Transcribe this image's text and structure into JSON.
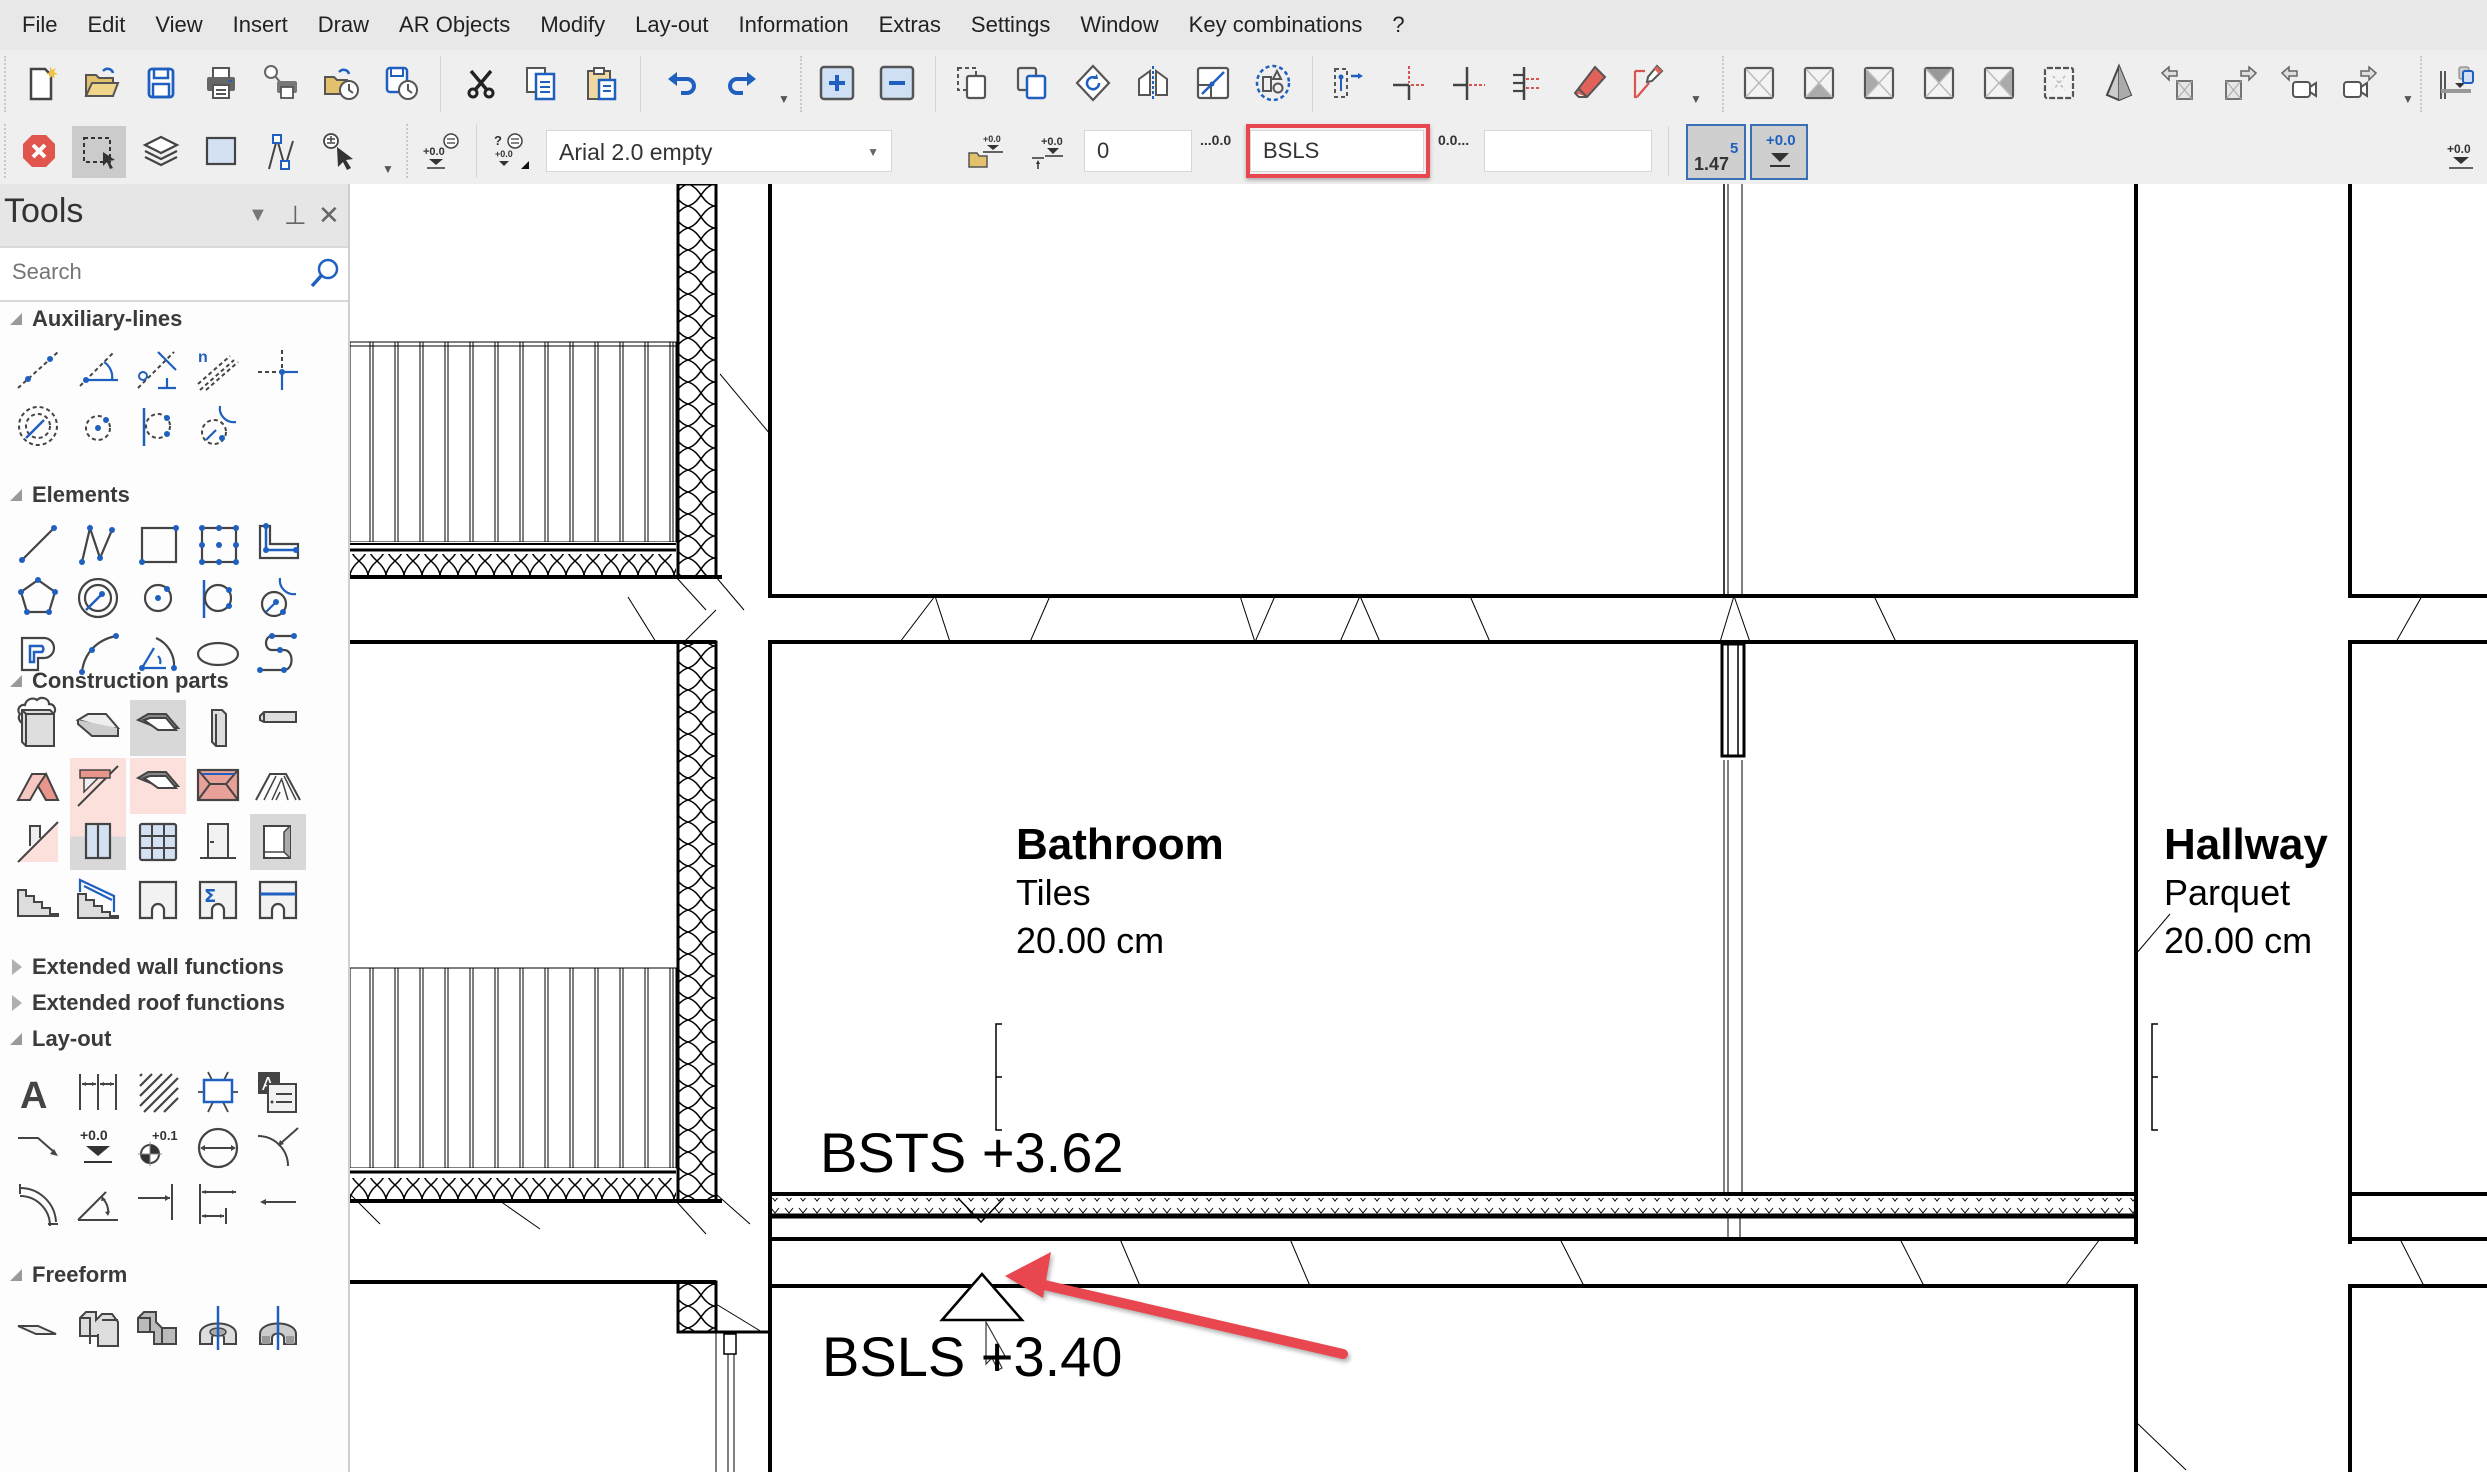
{
  "menu": [
    "File",
    "Edit",
    "View",
    "Insert",
    "Draw",
    "AR Objects",
    "Modify",
    "Lay-out",
    "Information",
    "Extras",
    "Settings",
    "Window",
    "Key combinations",
    "?"
  ],
  "toolbar1": {
    "icons": [
      "new-file",
      "open-folder",
      "save",
      "print",
      "print-preview",
      "open-recent",
      "save-as-timed",
      "cut",
      "copy",
      "paste",
      "undo",
      "redo",
      "zoom-in",
      "zoom-out",
      "select-dashed",
      "copy-object",
      "rotate",
      "mirror",
      "scale",
      "group",
      "align-move",
      "split-line",
      "trim-line",
      "extend-line",
      "eraser",
      "edit-pen",
      "view-1",
      "view-2",
      "view-3",
      "view-4",
      "view-5",
      "view-6",
      "perspective",
      "view-prev",
      "view-next",
      "camera-prev",
      "camera-next",
      "level-panel"
    ]
  },
  "toolbar2": {
    "font_select": "Arial 2.0 empty",
    "height_offset_label": "+0.0",
    "height_input": "0",
    "prefix_label": "...0.0",
    "prefix_input": "BSLS",
    "suffix_label": "0.0...",
    "suffix_input": "",
    "scale_button": "1.47",
    "scale_superscript": "5",
    "level_button_label": "+0.0"
  },
  "panel": {
    "title": "Tools",
    "search_placeholder": "Search",
    "sections": [
      {
        "label": "Auxiliary-lines",
        "expanded": true
      },
      {
        "label": "Elements",
        "expanded": true
      },
      {
        "label": "Construction parts",
        "expanded": true
      },
      {
        "label": "Extended wall functions",
        "expanded": false
      },
      {
        "label": "Extended roof functions",
        "expanded": false
      },
      {
        "label": "Lay-out",
        "expanded": true
      },
      {
        "label": "Freeform",
        "expanded": true
      }
    ],
    "layout_labels": {
      "level_tag": "+0.0",
      "coord_tag": "+0.1"
    }
  },
  "drawing": {
    "rooms": [
      {
        "name": "Bathroom",
        "material": "Tiles",
        "thickness": "20.00 cm"
      },
      {
        "name": "Hallway",
        "material": "Parquet",
        "thickness": "20.00 cm"
      }
    ],
    "levels": [
      {
        "label": "BSTS +3.62"
      },
      {
        "label": "BSLS +3.40"
      }
    ],
    "colors": {
      "highlight": "#e8474f",
      "accent_blue": "#1f5fbf"
    }
  }
}
